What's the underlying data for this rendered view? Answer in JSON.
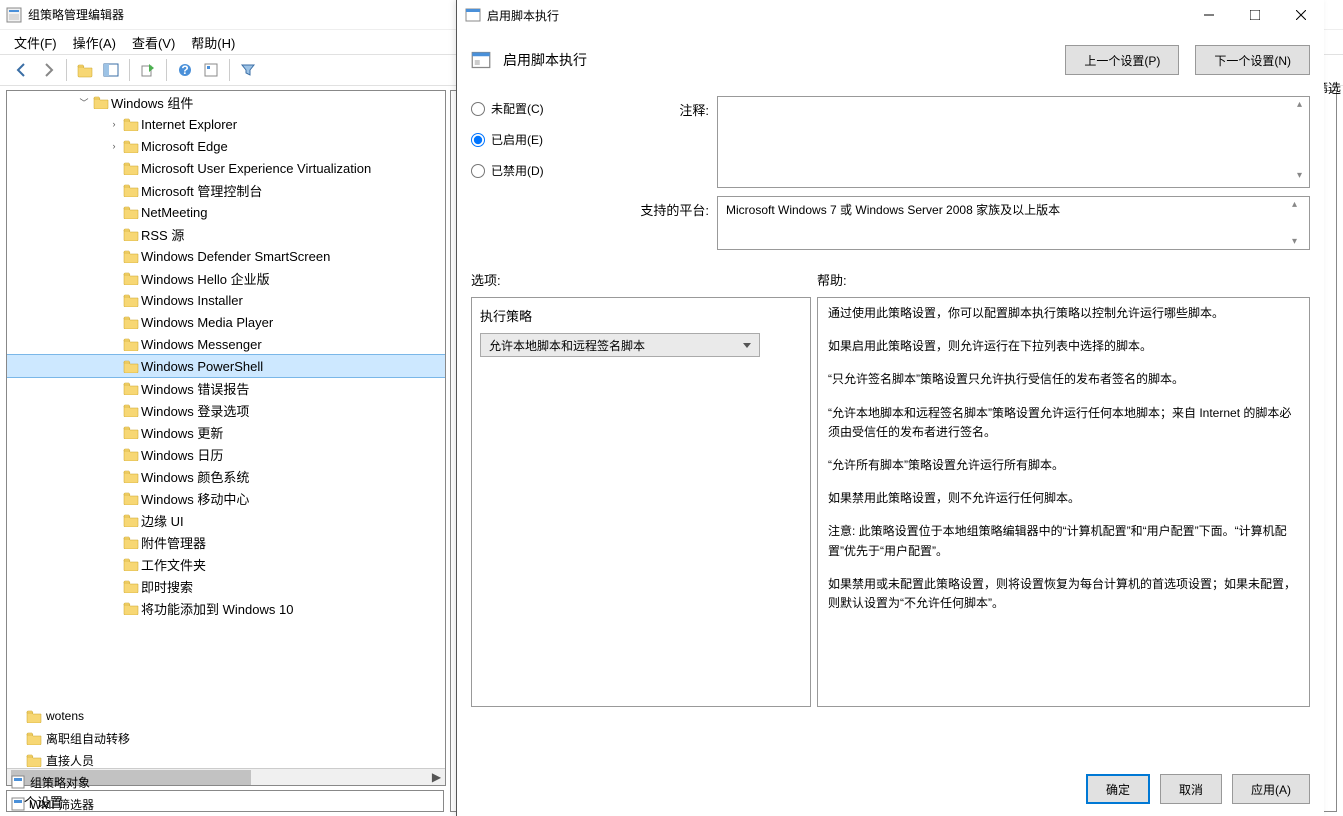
{
  "gp": {
    "title": "组策略管理编辑器",
    "menu": {
      "file": "文件(F)",
      "action": "操作(A)",
      "view": "查看(V)",
      "help": "帮助(H)"
    },
    "tree_root": "Windows 组件",
    "tree": [
      "Internet Explorer",
      "Microsoft Edge",
      "Microsoft User Experience Virtualization",
      "Microsoft 管理控制台",
      "NetMeeting",
      "RSS 源",
      "Windows Defender SmartScreen",
      "Windows Hello 企业版",
      "Windows Installer",
      "Windows Media Player",
      "Windows Messenger",
      "Windows PowerShell",
      "Windows 错误报告",
      "Windows 登录选项",
      "Windows 更新",
      "Windows 日历",
      "Windows 颜色系统",
      "Windows 移动中心",
      "边缘 UI",
      "附件管理器",
      "工作文件夹",
      "即时搜索",
      "将功能添加到 Windows 10"
    ],
    "selected_index": 11,
    "status": "5 个设置",
    "lower": [
      "wotens",
      "离职组自动转移",
      "直接人员",
      "组策略对象",
      "WMI 筛选器"
    ],
    "right_corner": "筛选"
  },
  "dlg": {
    "title": "启用脚本执行",
    "header": "启用脚本执行",
    "prev_btn": "上一个设置(P)",
    "next_btn": "下一个设置(N)",
    "radio_unconfigured": "未配置(C)",
    "radio_enabled": "已启用(E)",
    "radio_disabled": "已禁用(D)",
    "comment_label": "注释:",
    "platform_label": "支持的平台:",
    "platform_text": "Microsoft Windows 7 或 Windows Server 2008 家族及以上版本",
    "options_label": "选项:",
    "help_label": "帮助:",
    "policy_label": "执行策略",
    "policy_value": "允许本地脚本和远程签名脚本",
    "help_paragraphs": [
      "通过使用此策略设置，你可以配置脚本执行策略以控制允许运行哪些脚本。",
      "如果启用此策略设置，则允许运行在下拉列表中选择的脚本。",
      "“只允许签名脚本”策略设置只允许执行受信任的发布者签名的脚本。",
      "“允许本地脚本和远程签名脚本”策略设置允许运行任何本地脚本；来自 Internet 的脚本必须由受信任的发布者进行签名。",
      "“允许所有脚本”策略设置允许运行所有脚本。",
      "如果禁用此策略设置，则不允许运行任何脚本。",
      "注意: 此策略设置位于本地组策略编辑器中的“计算机配置”和“用户配置”下面。“计算机配置”优先于“用户配置”。",
      "如果禁用或未配置此策略设置，则将设置恢复为每台计算机的首选项设置；如果未配置，则默认设置为“不允许任何脚本”。"
    ],
    "ok": "确定",
    "cancel": "取消",
    "apply": "应用(A)"
  }
}
